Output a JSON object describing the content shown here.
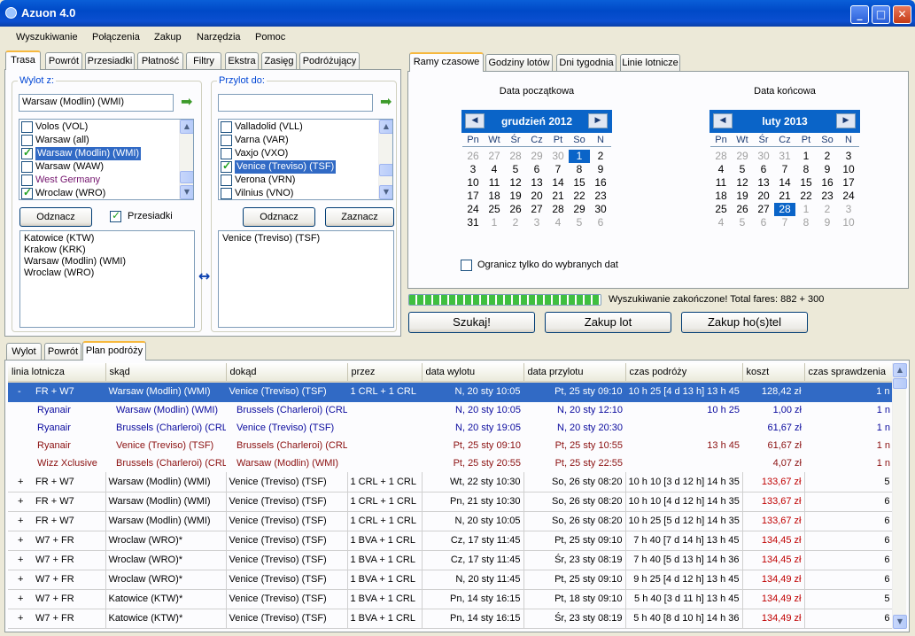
{
  "window": {
    "title": "Azuon 4.0",
    "minimize": "_",
    "maximize": "□",
    "close": "✕"
  },
  "menu": [
    "Wyszukiwanie",
    "Połączenia",
    "Zakup",
    "Narzędzia",
    "Pomoc"
  ],
  "left_tabs": [
    "Trasa",
    "Powrót",
    "Przesiadki",
    "Płatność",
    "Filtry",
    "Ekstra",
    "Zasięg",
    "Podróżujący"
  ],
  "from": {
    "label": "Wylot z:",
    "value": "Warsaw (Modlin) (WMI)",
    "list": [
      {
        "t": "Volos (VOL)",
        "c": false
      },
      {
        "t": "Warsaw (all)",
        "c": false
      },
      {
        "t": "Warsaw (Modlin) (WMI)",
        "c": true,
        "sel": true
      },
      {
        "t": "Warsaw (WAW)",
        "c": false
      },
      {
        "t": "West Germany",
        "c": false,
        "purple": true
      },
      {
        "t": "Wroclaw (WRO)",
        "c": true
      }
    ],
    "unmark": "Odznacz",
    "transfers": "Przesiadki",
    "selected": [
      "Katowice (KTW)",
      "Krakow (KRK)",
      "Warsaw (Modlin) (WMI)",
      "Wroclaw (WRO)"
    ]
  },
  "to": {
    "label": "Przylot do:",
    "value": "",
    "list": [
      {
        "t": "Valladolid (VLL)",
        "c": false
      },
      {
        "t": "Varna (VAR)",
        "c": false
      },
      {
        "t": "Vaxjo (VXO)",
        "c": false
      },
      {
        "t": "Venice (Treviso) (TSF)",
        "c": true,
        "sel": true
      },
      {
        "t": "Verona (VRN)",
        "c": false
      },
      {
        "t": "Vilnius (VNO)",
        "c": false
      }
    ],
    "unmark": "Odznacz",
    "mark": "Zaznacz",
    "selected": [
      "Venice (Treviso) (TSF)"
    ]
  },
  "swap_icon": "↔",
  "right_tabs": [
    "Ramy czasowe",
    "Godziny lotów",
    "Dni tygodnia",
    "Linie lotnicze"
  ],
  "start_title": "Data początkowa",
  "end_title": "Data końcowa",
  "dows": [
    "Pn",
    "Wt",
    "Śr",
    "Cz",
    "Pt",
    "So",
    "N"
  ],
  "cal1": {
    "month": "grudzień 2012",
    "days": [
      "26",
      "27",
      "28",
      "29",
      "30",
      "1",
      "2",
      "3",
      "4",
      "5",
      "6",
      "7",
      "8",
      "9",
      "10",
      "11",
      "12",
      "13",
      "14",
      "15",
      "16",
      "17",
      "18",
      "19",
      "20",
      "21",
      "22",
      "23",
      "24",
      "25",
      "26",
      "27",
      "28",
      "29",
      "30",
      "31",
      "1",
      "2",
      "3",
      "4",
      "5",
      "6"
    ],
    "dim_before": 5,
    "dim_after_from": 36,
    "sel": 5
  },
  "cal2": {
    "month": "luty 2013",
    "days": [
      "28",
      "29",
      "30",
      "31",
      "1",
      "2",
      "3",
      "4",
      "5",
      "6",
      "7",
      "8",
      "9",
      "10",
      "11",
      "12",
      "13",
      "14",
      "15",
      "16",
      "17",
      "18",
      "19",
      "20",
      "21",
      "22",
      "23",
      "24",
      "25",
      "26",
      "27",
      "28",
      "1",
      "2",
      "3",
      "4",
      "5",
      "6",
      "7",
      "8",
      "9",
      "10"
    ],
    "dim_before": 4,
    "dim_after_from": 32,
    "sel": 31
  },
  "limit_dates": "Ogranicz tylko do wybranych dat",
  "progress": 1.0,
  "status": "Wyszukiwanie zakończone! Total fares: 882 + 300",
  "buttons": {
    "search": "Szukaj!",
    "buy_flight": "Zakup lot",
    "buy_hotel": "Zakup ho(s)tel"
  },
  "bottom_tabs": [
    "Wylot",
    "Powrót",
    "Plan podróży"
  ],
  "columns": [
    "linia lotnicza",
    "skąd",
    "dokąd",
    "przez",
    "data wylotu",
    "data przylotu",
    "czas podróży",
    "koszt",
    "czas sprawdzenia"
  ],
  "rows": [
    {
      "k": "main",
      "sel": true,
      "exp": "-",
      "air": "FR + W7",
      "from": "Warsaw (Modlin) (WMI)",
      "to": "Venice (Treviso) (TSF)",
      "via": "1 CRL + 1 CRL",
      "dep": "N, 20 sty 10:05",
      "arr": "Pt, 25 sty 09:10",
      "dur": "10 h 25 [4 d 13 h] 13 h 45",
      "cost": "128,42 zł",
      "chk": "1 n"
    },
    {
      "k": "sub",
      "c": "blue",
      "air": "Ryanair",
      "from": "Warsaw (Modlin) (WMI)",
      "to": "Brussels (Charleroi) (CRL)",
      "via": "",
      "dep": "N, 20 sty 10:05",
      "arr": "N, 20 sty 12:10",
      "dur": "10 h 25",
      "cost": "1,00 zł",
      "chk": "1 n"
    },
    {
      "k": "sub",
      "c": "blue",
      "air": "Ryanair",
      "from": "Brussels (Charleroi) (CRL)",
      "to": "Venice (Treviso) (TSF)",
      "via": "",
      "dep": "N, 20 sty 19:05",
      "arr": "N, 20 sty 20:30",
      "dur": "",
      "cost": "61,67 zł",
      "chk": "1 n"
    },
    {
      "k": "sub",
      "c": "darkred",
      "air": "Ryanair",
      "from": "Venice (Treviso) (TSF)",
      "to": "Brussels (Charleroi) (CRL)",
      "via": "",
      "dep": "Pt, 25 sty 09:10",
      "arr": "Pt, 25 sty 10:55",
      "dur": "13 h 45",
      "cost": "61,67 zł",
      "chk": "1 n"
    },
    {
      "k": "sub",
      "c": "darkred",
      "air": "Wizz Xclusive",
      "from": "Brussels (Charleroi) (CRL)",
      "to": "Warsaw (Modlin) (WMI)",
      "via": "",
      "dep": "Pt, 25 sty 20:55",
      "arr": "Pt, 25 sty 22:55",
      "dur": "",
      "cost": "4,07 zł",
      "chk": "1 n"
    },
    {
      "k": "main",
      "exp": "+",
      "air": "FR + W7",
      "from": "Warsaw (Modlin) (WMI)",
      "to": "Venice (Treviso) (TSF)",
      "via": "1 CRL + 1 CRL",
      "dep": "Wt, 22 sty 10:30",
      "arr": "So, 26 sty 08:20",
      "dur": "10 h 10 [3 d 12 h] 14 h 35",
      "cost": "133,67 zł",
      "chk": "5"
    },
    {
      "k": "main",
      "exp": "+",
      "air": "FR + W7",
      "from": "Warsaw (Modlin) (WMI)",
      "to": "Venice (Treviso) (TSF)",
      "via": "1 CRL + 1 CRL",
      "dep": "Pn, 21 sty 10:30",
      "arr": "So, 26 sty 08:20",
      "dur": "10 h 10 [4 d 12 h] 14 h 35",
      "cost": "133,67 zł",
      "chk": "6"
    },
    {
      "k": "main",
      "exp": "+",
      "air": "FR + W7",
      "from": "Warsaw (Modlin) (WMI)",
      "to": "Venice (Treviso) (TSF)",
      "via": "1 CRL + 1 CRL",
      "dep": "N, 20 sty 10:05",
      "arr": "So, 26 sty 08:20",
      "dur": "10 h 25 [5 d 12 h] 14 h 35",
      "cost": "133,67 zł",
      "chk": "6"
    },
    {
      "k": "main",
      "exp": "+",
      "air": "W7 + FR",
      "from": "Wroclaw (WRO)*",
      "to": "Venice (Treviso) (TSF)",
      "via": "1 BVA + 1 CRL",
      "dep": "Cz, 17 sty 11:45",
      "arr": "Pt, 25 sty 09:10",
      "dur": "7 h 40 [7 d 14 h] 13 h 45",
      "cost": "134,45 zł",
      "chk": "6"
    },
    {
      "k": "main",
      "exp": "+",
      "air": "W7 + FR",
      "from": "Wroclaw (WRO)*",
      "to": "Venice (Treviso) (TSF)",
      "via": "1 BVA + 1 CRL",
      "dep": "Cz, 17 sty 11:45",
      "arr": "Śr, 23 sty 08:19",
      "dur": "7 h 40 [5 d 13 h] 14 h 36",
      "cost": "134,45 zł",
      "chk": "6"
    },
    {
      "k": "main",
      "exp": "+",
      "air": "W7 + FR",
      "from": "Wroclaw (WRO)*",
      "to": "Venice (Treviso) (TSF)",
      "via": "1 BVA + 1 CRL",
      "dep": "N, 20 sty 11:45",
      "arr": "Pt, 25 sty 09:10",
      "dur": "9 h 25 [4 d 12 h] 13 h 45",
      "cost": "134,49 zł",
      "chk": "6"
    },
    {
      "k": "main",
      "exp": "+",
      "air": "W7 + FR",
      "from": "Katowice (KTW)*",
      "to": "Venice (Treviso) (TSF)",
      "via": "1 BVA + 1 CRL",
      "dep": "Pn, 14 sty 16:15",
      "arr": "Pt, 18 sty 09:10",
      "dur": "5 h 40 [3 d 11 h] 13 h 45",
      "cost": "134,49 zł",
      "chk": "5"
    },
    {
      "k": "main",
      "exp": "+",
      "air": "W7 + FR",
      "from": "Katowice (KTW)*",
      "to": "Venice (Treviso) (TSF)",
      "via": "1 BVA + 1 CRL",
      "dep": "Pn, 14 sty 16:15",
      "arr": "Śr, 23 sty 08:19",
      "dur": "5 h 40 [8 d 10 h] 14 h 36",
      "cost": "134,49 zł",
      "chk": "6"
    }
  ]
}
